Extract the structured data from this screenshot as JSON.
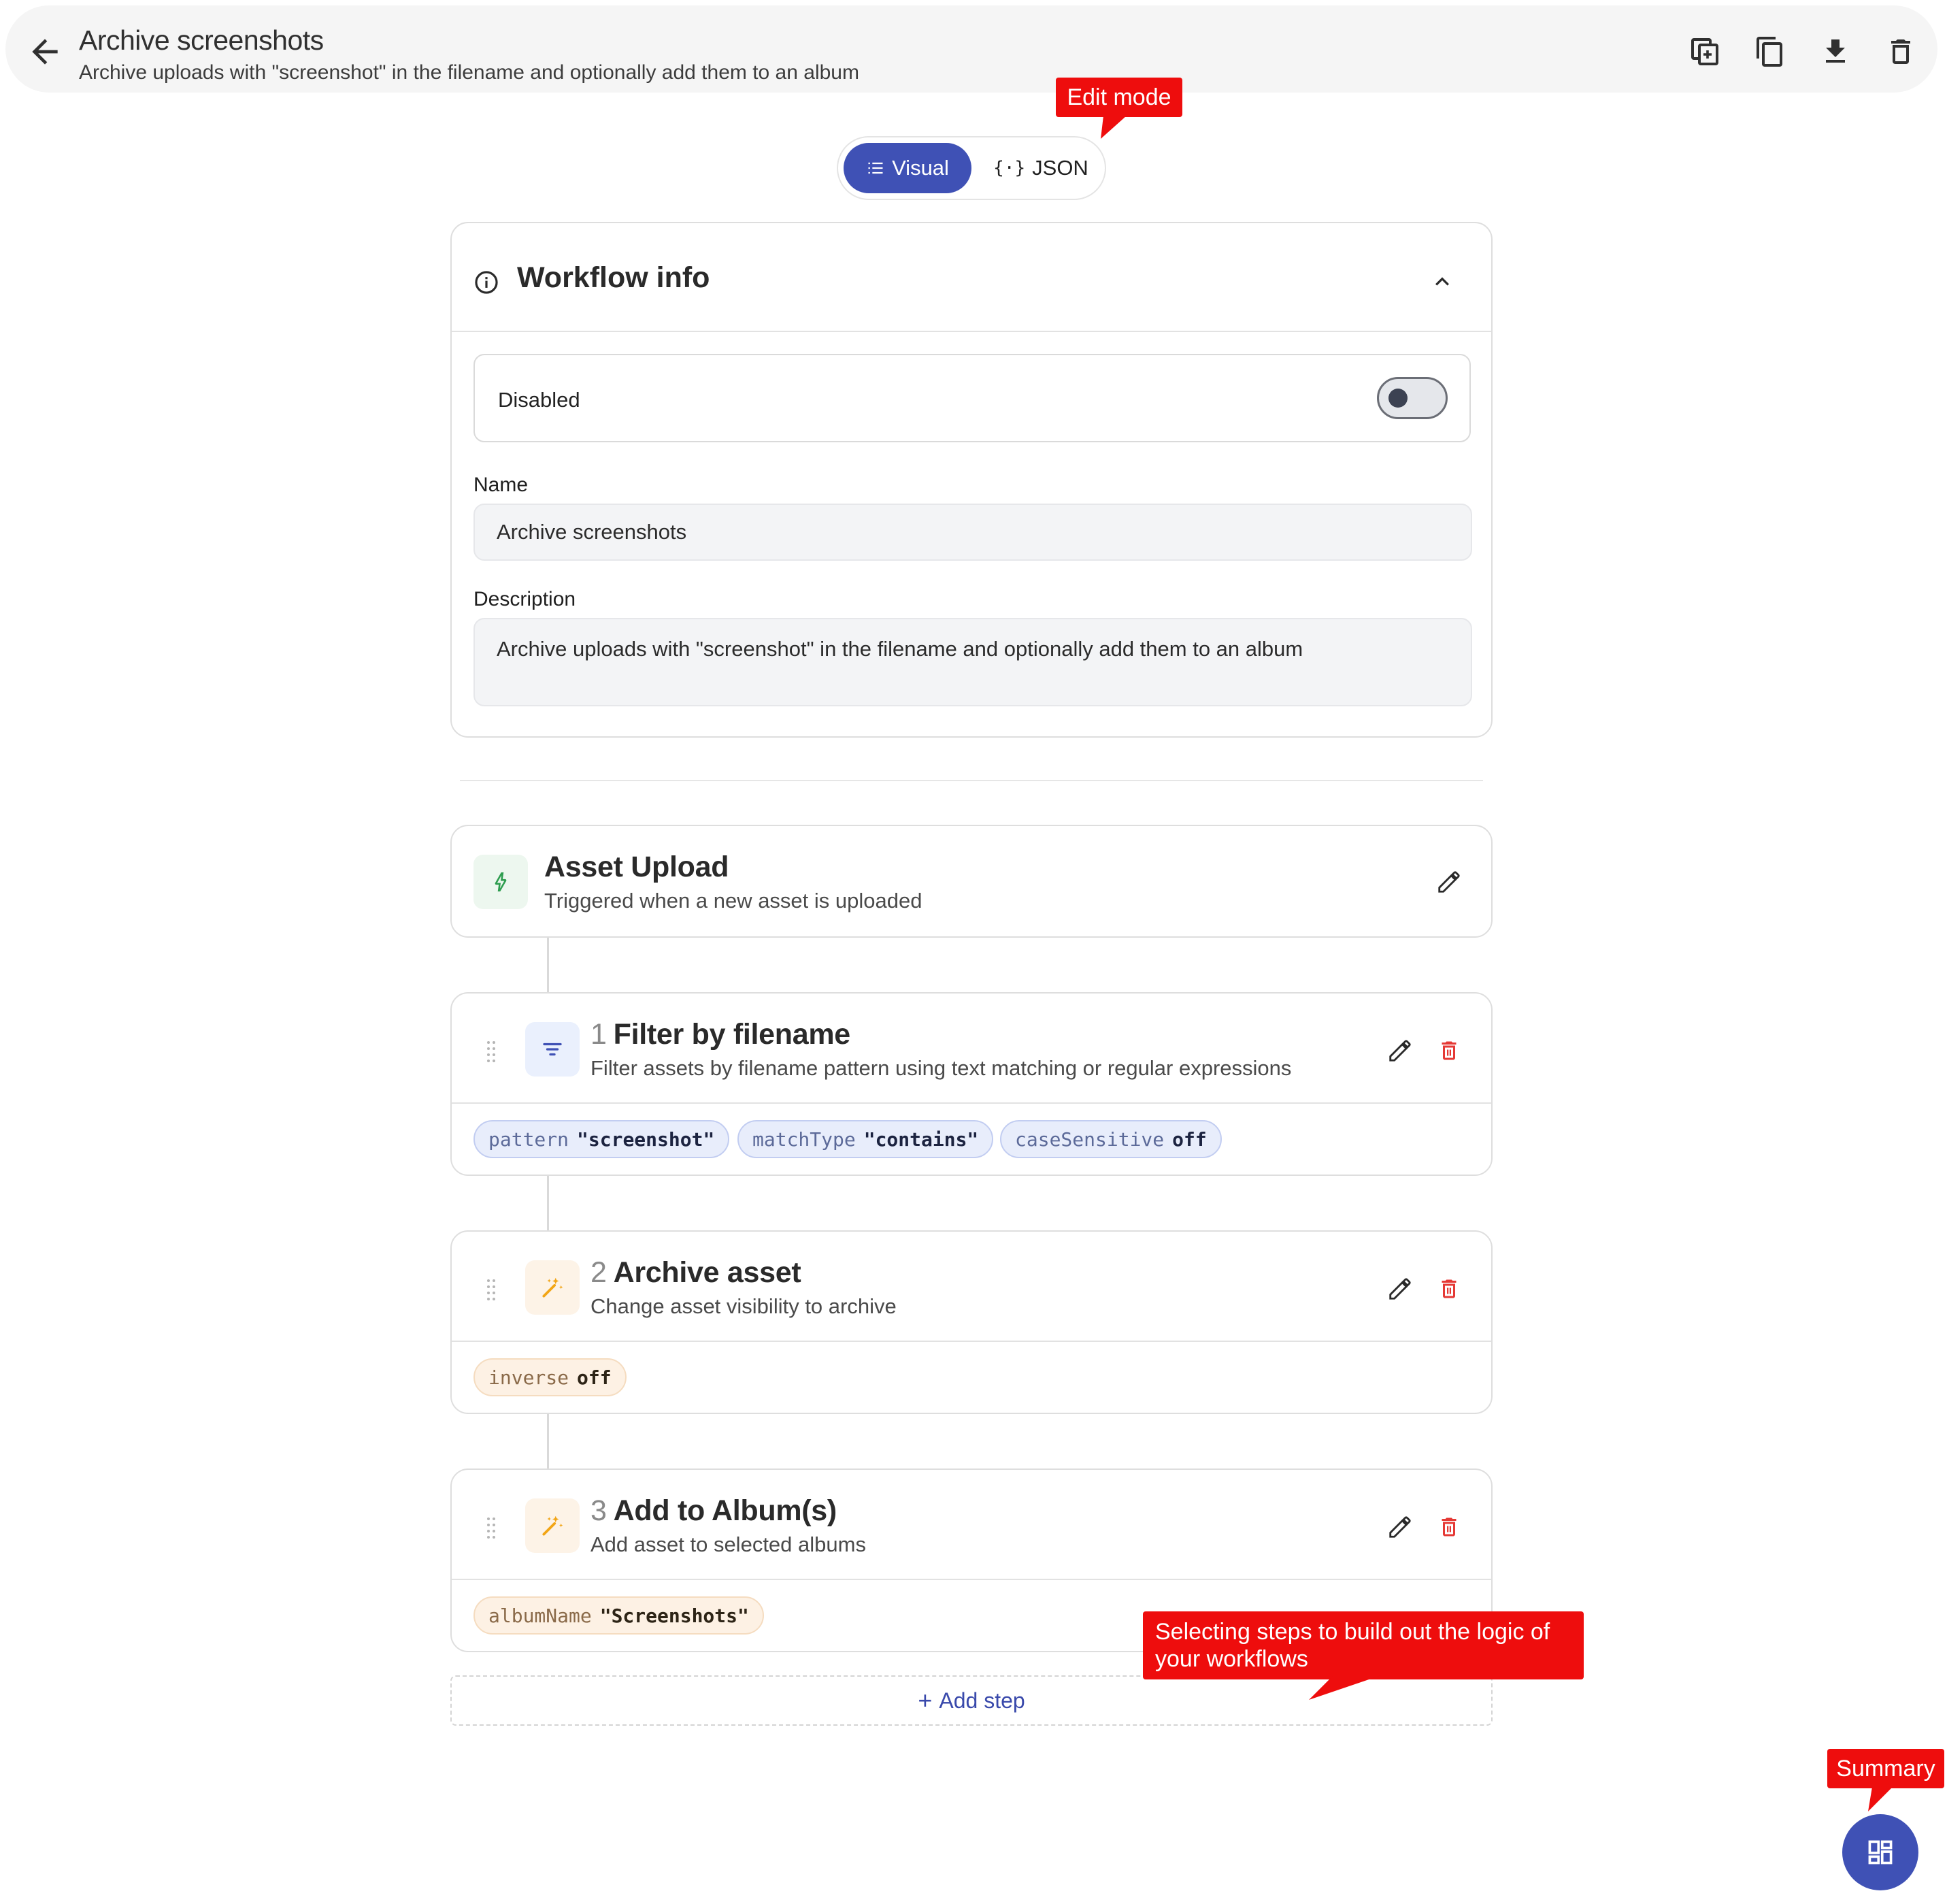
{
  "header": {
    "title": "Archive screenshots",
    "subtitle": "Archive uploads with \"screenshot\" in the filename and optionally add them to an album",
    "actions": [
      "duplicate-icon",
      "copy-icon",
      "download-icon",
      "delete-icon"
    ]
  },
  "mode_toggle": {
    "visual_label": "Visual",
    "json_label": "JSON",
    "selected": "Visual"
  },
  "callouts": {
    "edit_mode": "Edit mode",
    "steps_hint": "Selecting steps to build out the logic of your workflows",
    "summary": "Summary"
  },
  "workflow_info": {
    "title": "Workflow info",
    "disabled_label": "Disabled",
    "disabled_on": false,
    "name_label": "Name",
    "name_value": "Archive screenshots",
    "description_label": "Description",
    "description_value": "Archive uploads with \"screenshot\" in the filename and optionally add them to an album"
  },
  "trigger": {
    "title": "Asset Upload",
    "subtitle": "Triggered when a new asset is uploaded"
  },
  "steps": [
    {
      "number": "1",
      "title": "Filter by filename",
      "subtitle": "Filter assets by filename pattern using text matching or regular expressions",
      "params": [
        {
          "key": "pattern",
          "value": "\"screenshot\""
        },
        {
          "key": "matchType",
          "value": "\"contains\""
        },
        {
          "key": "caseSensitive",
          "value": "off"
        }
      ]
    },
    {
      "number": "2",
      "title": "Archive asset",
      "subtitle": "Change asset visibility to archive",
      "params": [
        {
          "key": "inverse",
          "value": "off"
        }
      ]
    },
    {
      "number": "3",
      "title": "Add to Album(s)",
      "subtitle": "Add asset to selected albums",
      "params": [
        {
          "key": "albumName",
          "value": "\"Screenshots\""
        }
      ]
    }
  ],
  "add_step_label": "Add step",
  "colors": {
    "accent": "#3f51b5",
    "callout": "#ee0d0d",
    "delete": "#e53935",
    "chip_blue_bg": "#e8edfb",
    "chip_orange_bg": "#fdf1e4"
  }
}
